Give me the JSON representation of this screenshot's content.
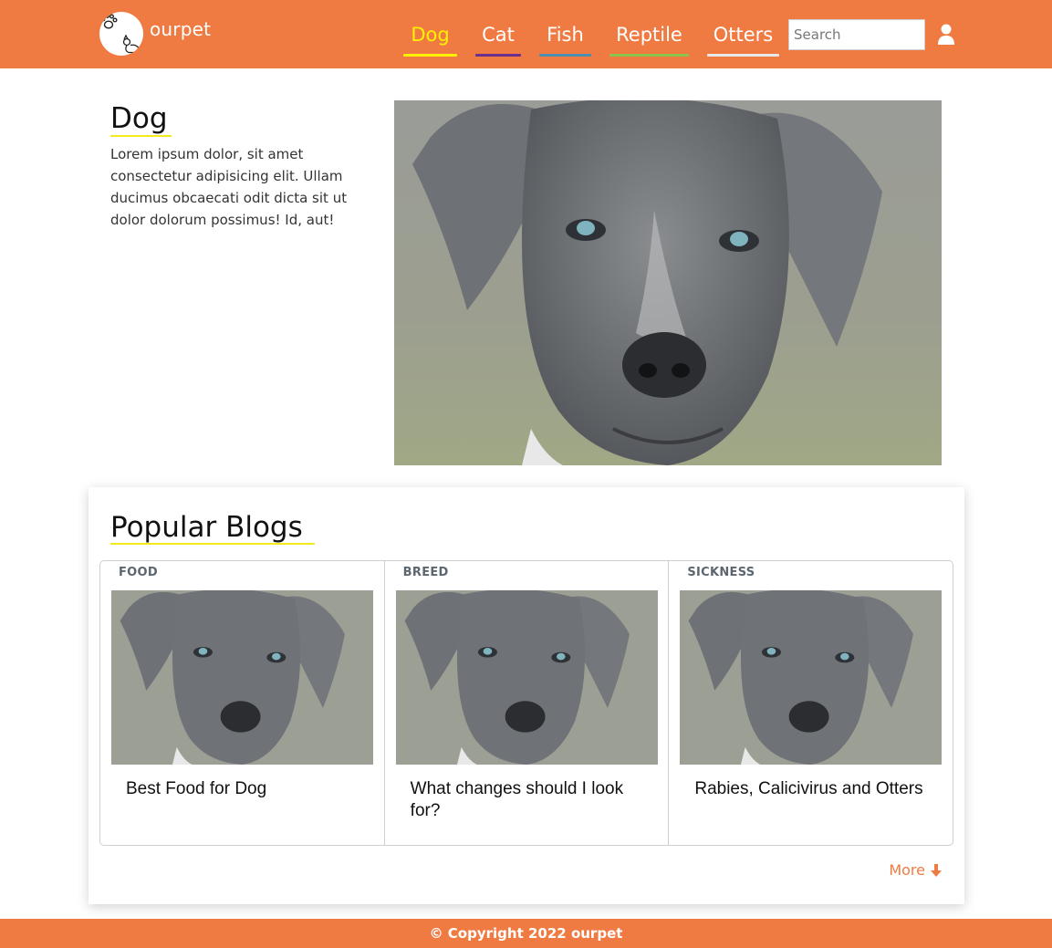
{
  "brand": {
    "name": "ourpet"
  },
  "nav": {
    "items": [
      {
        "label": "Dog",
        "active": true,
        "underline_color": "#fff200"
      },
      {
        "label": "Cat",
        "active": false,
        "underline_color": "#6b2f8e"
      },
      {
        "label": "Fish",
        "active": false,
        "underline_color": "#4a8fb0"
      },
      {
        "label": "Reptile",
        "active": false,
        "underline_color": "#8cc34a"
      },
      {
        "label": "Otters",
        "active": false,
        "underline_color": "#e8e8e8"
      }
    ],
    "search_placeholder": "Search",
    "user_icon": "user-icon"
  },
  "hero": {
    "title": "Dog",
    "text": "Lorem ipsum dolor, sit amet consectetur adipisicing elit. Ullam ducimus obcaecati odit dicta sit ut dolor dolorum possimus! Id, aut!"
  },
  "blogs": {
    "title": "Popular Blogs",
    "items": [
      {
        "category": "FOOD",
        "headline": "Best Food for Dog"
      },
      {
        "category": "BREED",
        "headline": "What changes should I look for?"
      },
      {
        "category": "SICKNESS",
        "headline": "Rabies, Calicivirus and Otters"
      }
    ],
    "more_label": "More"
  },
  "footer": {
    "text": "© Copyright 2022 ourpet"
  },
  "colors": {
    "accent": "#ef7b43",
    "underline": "#f2ea1b"
  }
}
